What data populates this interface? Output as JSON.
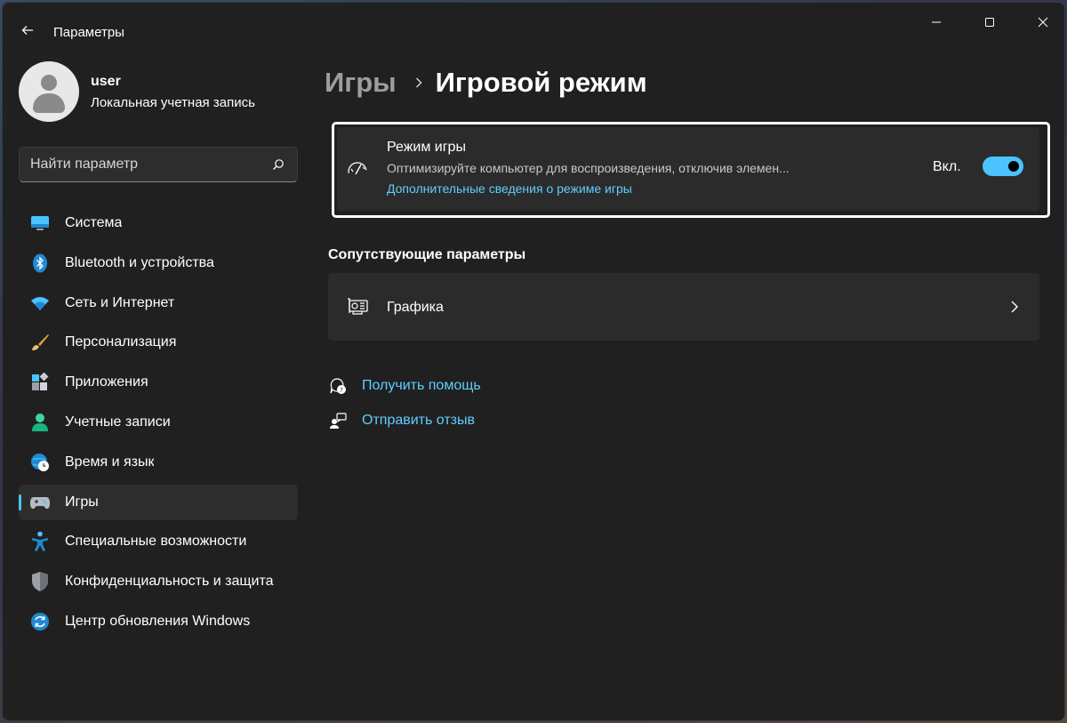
{
  "window": {
    "title": "Параметры"
  },
  "profile": {
    "name": "user",
    "account_type": "Локальная учетная запись"
  },
  "search": {
    "placeholder": "Найти параметр"
  },
  "sidebar": {
    "items": [
      {
        "label": "Система",
        "icon": "monitor-icon"
      },
      {
        "label": "Bluetooth и устройства",
        "icon": "bluetooth-icon"
      },
      {
        "label": "Сеть и Интернет",
        "icon": "wifi-icon"
      },
      {
        "label": "Персонализация",
        "icon": "brush-icon"
      },
      {
        "label": "Приложения",
        "icon": "apps-icon"
      },
      {
        "label": "Учетные записи",
        "icon": "person-icon"
      },
      {
        "label": "Время и язык",
        "icon": "globe-clock-icon"
      },
      {
        "label": "Игры",
        "icon": "gamepad-icon",
        "active": true
      },
      {
        "label": "Специальные возможности",
        "icon": "accessibility-icon"
      },
      {
        "label": "Конфиденциальность и защита",
        "icon": "shield-icon"
      },
      {
        "label": "Центр обновления Windows",
        "icon": "update-icon"
      }
    ]
  },
  "breadcrumb": {
    "parent": "Игры",
    "current": "Игровой режим"
  },
  "game_mode": {
    "title": "Режим игры",
    "description": "Оптимизируйте компьютер для воспроизведения, отключив элемен...",
    "link": "Дополнительные сведения о режиме игры",
    "toggle_label": "Вкл.",
    "toggle_on": true
  },
  "related": {
    "title": "Сопутствующие параметры",
    "graphics_label": "Графика"
  },
  "help": {
    "get_help": "Получить помощь",
    "feedback": "Отправить отзыв"
  },
  "colors": {
    "accent": "#4cc2ff",
    "link": "#60cdff",
    "background": "#202020",
    "card": "#2b2b2b"
  }
}
